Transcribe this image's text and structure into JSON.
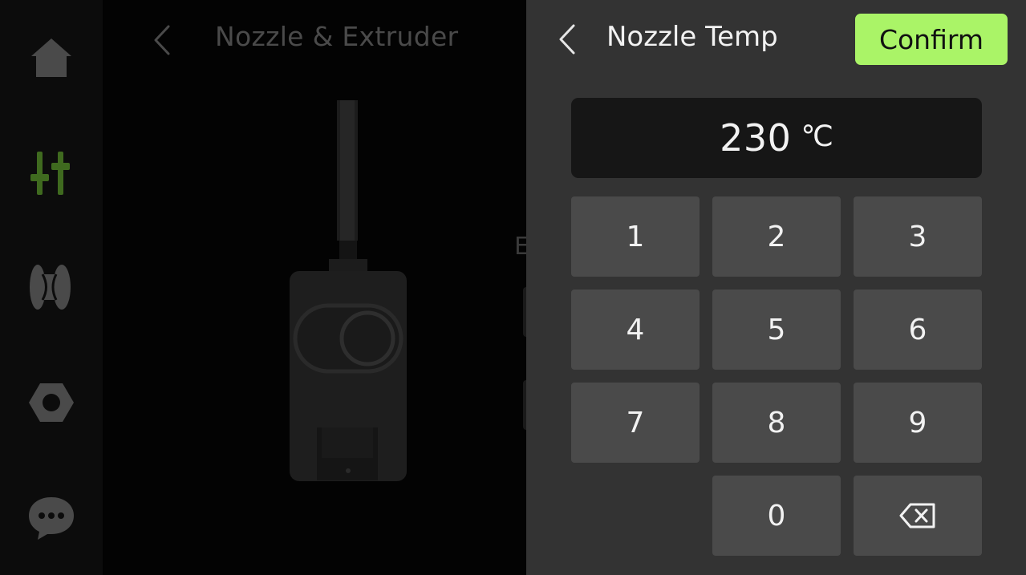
{
  "sidebar": {
    "items": [
      {
        "icon": "home-icon",
        "color": "#4a4a4a"
      },
      {
        "icon": "adjust-sliders-icon",
        "color": "#3f6a1f"
      },
      {
        "icon": "filament-spool-icon",
        "color": "#4a4a4a"
      },
      {
        "icon": "hex-nut-icon",
        "color": "#4a4a4a"
      },
      {
        "icon": "chat-bubble-icon",
        "color": "#4a4a4a"
      }
    ]
  },
  "background_page": {
    "title": "Nozzle & Extruder",
    "peek_text": "E"
  },
  "panel": {
    "title": "Nozzle Temp",
    "confirm_label": "Confirm",
    "value": "230",
    "unit": "℃"
  },
  "keypad": {
    "keys": [
      "1",
      "2",
      "3",
      "4",
      "5",
      "6",
      "7",
      "8",
      "9",
      "0"
    ],
    "backspace_icon": "backspace-icon"
  },
  "colors": {
    "accent": "#aaf467",
    "panel_bg": "#333333",
    "key_bg": "#4a4a4a",
    "display_bg": "#161616"
  }
}
